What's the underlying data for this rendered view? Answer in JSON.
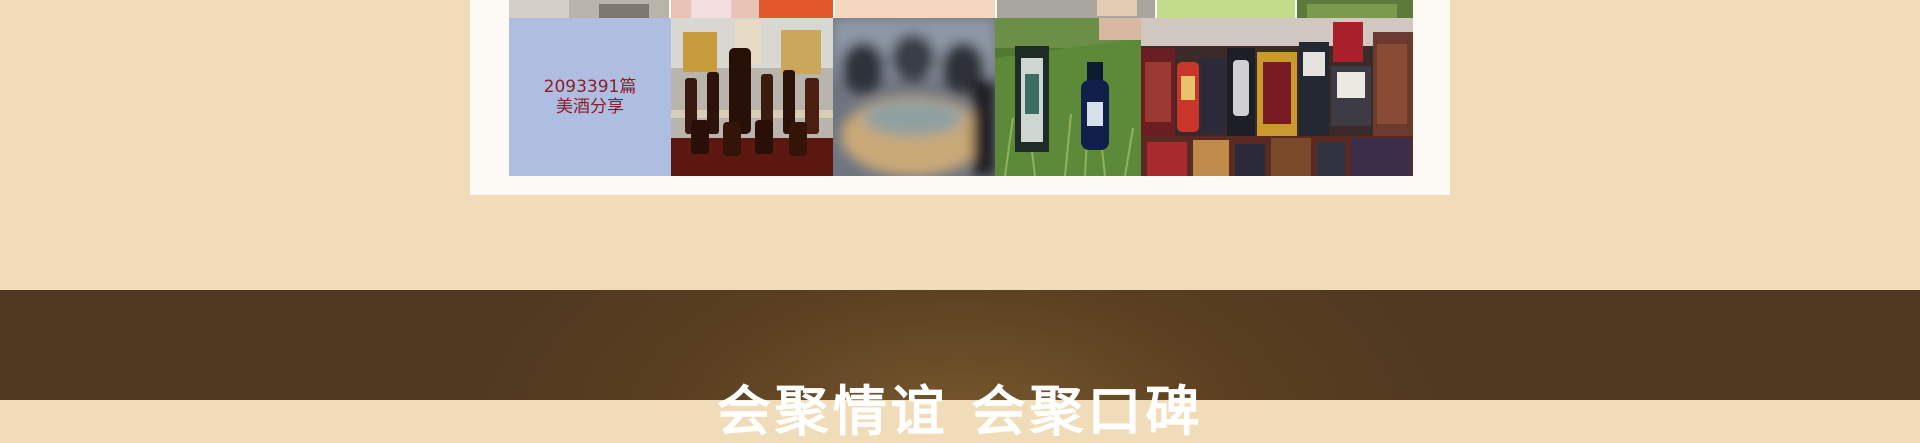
{
  "stat_tile": {
    "count": "2093391篇",
    "label": "美酒分享"
  },
  "banner": {
    "headline": "会聚情谊 会聚口碑"
  },
  "colors": {
    "beige_background": "#f1dcb9",
    "panel_white": "#fdfaf6",
    "stat_tile_blue": "#aebee0",
    "stat_text_red": "#8c1d2a",
    "brown_band": "#5a3f21"
  }
}
